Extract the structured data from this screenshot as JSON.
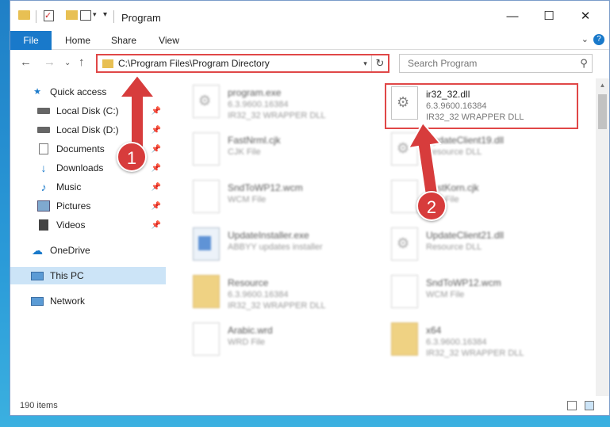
{
  "window": {
    "title": "Program"
  },
  "ribbon": {
    "tabs": [
      "File",
      "Home",
      "Share",
      "View"
    ],
    "help": "?"
  },
  "address": {
    "path": "C:\\Program Files\\Program Directory"
  },
  "search": {
    "placeholder": "Search Program"
  },
  "sidebar": {
    "items": [
      {
        "label": "Quick access",
        "icon": "star-icon",
        "pinned": false
      },
      {
        "label": "Local Disk (C:)",
        "icon": "drive-icon",
        "pinned": true
      },
      {
        "label": "Local Disk (D:)",
        "icon": "drive-icon",
        "pinned": true
      },
      {
        "label": "Documents",
        "icon": "documents-icon",
        "pinned": true
      },
      {
        "label": "Downloads",
        "icon": "download-icon",
        "pinned": true
      },
      {
        "label": "Music",
        "icon": "music-icon",
        "pinned": true
      },
      {
        "label": "Pictures",
        "icon": "pictures-icon",
        "pinned": true
      },
      {
        "label": "Videos",
        "icon": "videos-icon",
        "pinned": true
      },
      {
        "label": "OneDrive",
        "icon": "cloud-icon",
        "pinned": false
      },
      {
        "label": "This PC",
        "icon": "computer-icon",
        "pinned": false
      },
      {
        "label": "Network",
        "icon": "network-icon",
        "pinned": false
      }
    ]
  },
  "files": {
    "left": [
      {
        "name": "program.exe",
        "line1": "6.3.9600.16384",
        "line2": "IR32_32 WRAPPER DLL"
      },
      {
        "name": "FastNrml.cjk",
        "line1": "CJK File",
        "line2": ""
      },
      {
        "name": "SndToWP12.wcm",
        "line1": "WCM File",
        "line2": ""
      },
      {
        "name": "UpdateInstaller.exe",
        "line1": "ABBYY updates installer",
        "line2": ""
      },
      {
        "name": "Resource",
        "line1": "6.3.9600.16384",
        "line2": "IR32_32 WRAPPER DLL"
      },
      {
        "name": "Arabic.wrd",
        "line1": "WRD File",
        "line2": ""
      }
    ],
    "right": [
      {
        "name": "ir32_32.dll",
        "line1": "6.3.9600.16384",
        "line2": "IR32_32 WRAPPER DLL"
      },
      {
        "name": "UpdateClient19.dll",
        "line1": "Resource DLL",
        "line2": ""
      },
      {
        "name": "FastKorn.cjk",
        "line1": "CJK File",
        "line2": ""
      },
      {
        "name": "UpdateClient21.dll",
        "line1": "Resource DLL",
        "line2": ""
      },
      {
        "name": "SndToWP12.wcm",
        "line1": "WCM File",
        "line2": ""
      },
      {
        "name": "x64",
        "line1": "6.3.9600.16384",
        "line2": "IR32_32 WRAPPER DLL"
      }
    ]
  },
  "status": {
    "count": "190 items"
  },
  "annotations": {
    "step1": "1",
    "step2": "2"
  },
  "colors": {
    "accent": "#1979ca",
    "highlight": "#e04747",
    "selected": "#cce4f7"
  }
}
